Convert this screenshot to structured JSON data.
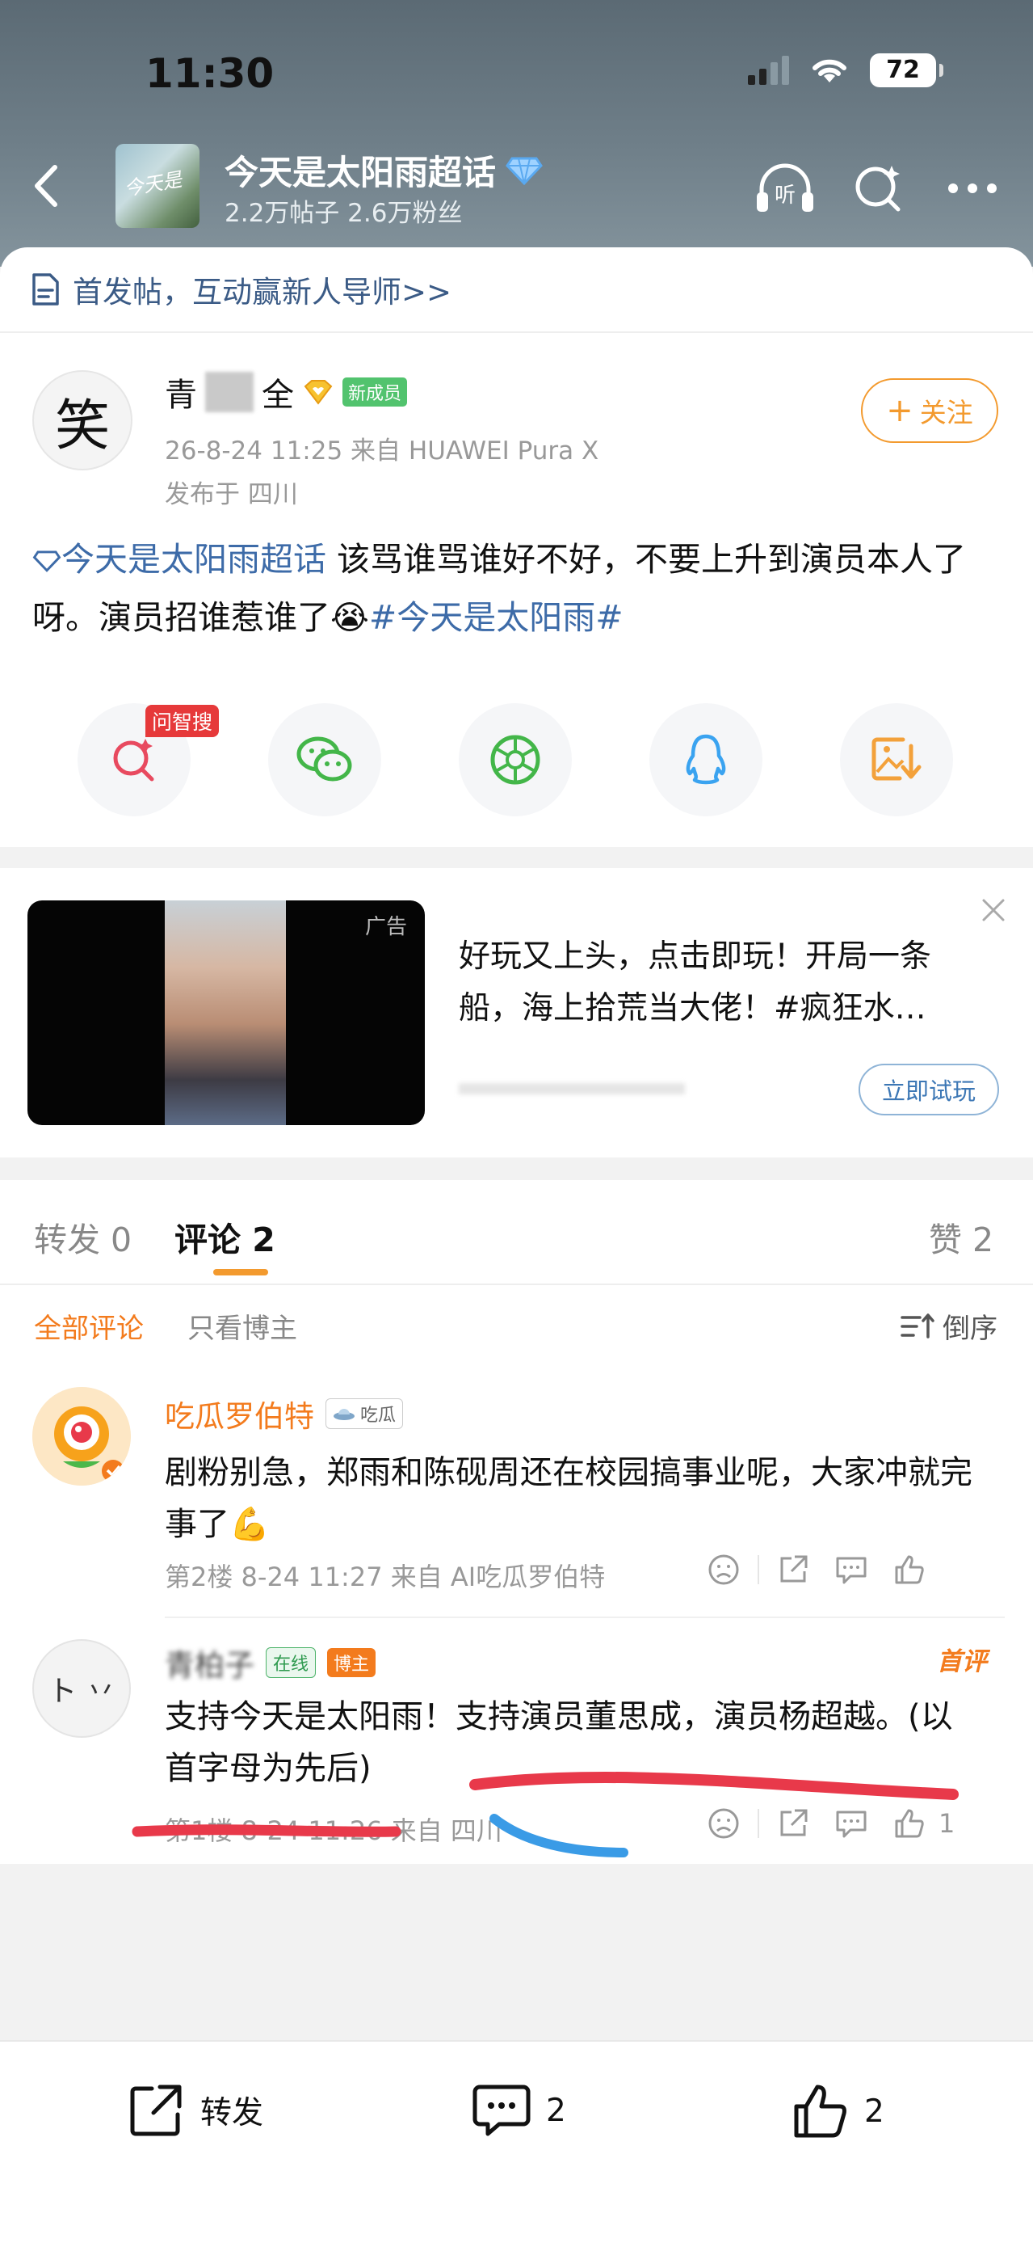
{
  "status_bar": {
    "time": "11:30",
    "battery": "72"
  },
  "header": {
    "topic_title": "今天是太阳雨超话",
    "topic_stats": "2.2万帖子 2.6万粉丝",
    "thumb_text": "今天是"
  },
  "banner": {
    "text": "首发帖，互动赢新人导师>>"
  },
  "post": {
    "avatar_char": "笑",
    "user_name_start": "青",
    "user_name_end": "全",
    "member_badge": "新成员",
    "time_source": "26-8-24 11:25  来自 HUAWEI Pura X",
    "location": "发布于 四川",
    "follow_label": "关注",
    "text_topic": "今天是太阳雨超话",
    "text_body": " 该骂谁骂谁好不好，不要上升到演员本人了呀。演员招谁惹谁了",
    "text_emoji": "😭",
    "text_hashtag": "#今天是太阳雨#"
  },
  "share": {
    "ai_tag": "问智搜"
  },
  "ad": {
    "label": "广告",
    "text": "好玩又上头，点击即玩！开局一条船，海上拾荒当大佬！#疯狂水…",
    "cta": "立即试玩"
  },
  "comment_tabs": {
    "repost": "转发 0",
    "comment": "评论 2",
    "like": "赞 2"
  },
  "comment_filters": {
    "all": "全部评论",
    "author_only": "只看博主",
    "sort": "倒序"
  },
  "comments": [
    {
      "name": "吃瓜罗伯特",
      "tag": "吃瓜",
      "text": "剧粉别急，郑雨和陈砚周还在校园搞事业呢，大家冲就完事了💪",
      "meta": "第2楼  8-24 11:27  来自 AI吃瓜罗伯特",
      "likes": ""
    },
    {
      "name": "青柏子",
      "online": "在线",
      "author_tag": "博主",
      "first_tag": "首评",
      "text": "支持今天是太阳雨！支持演员董思成，演员杨超越。(以首字母为先后)",
      "meta": "第1楼  8-24 11:26  来自 四川",
      "likes": "1"
    }
  ],
  "bottom_bar": {
    "repost": "转发",
    "comment_count": "2",
    "like_count": "2"
  },
  "colors": {
    "accent": "#f39a2e",
    "link": "#3d6ba8",
    "annotation_red": "#e8394a",
    "annotation_blue": "#3a9be6"
  }
}
